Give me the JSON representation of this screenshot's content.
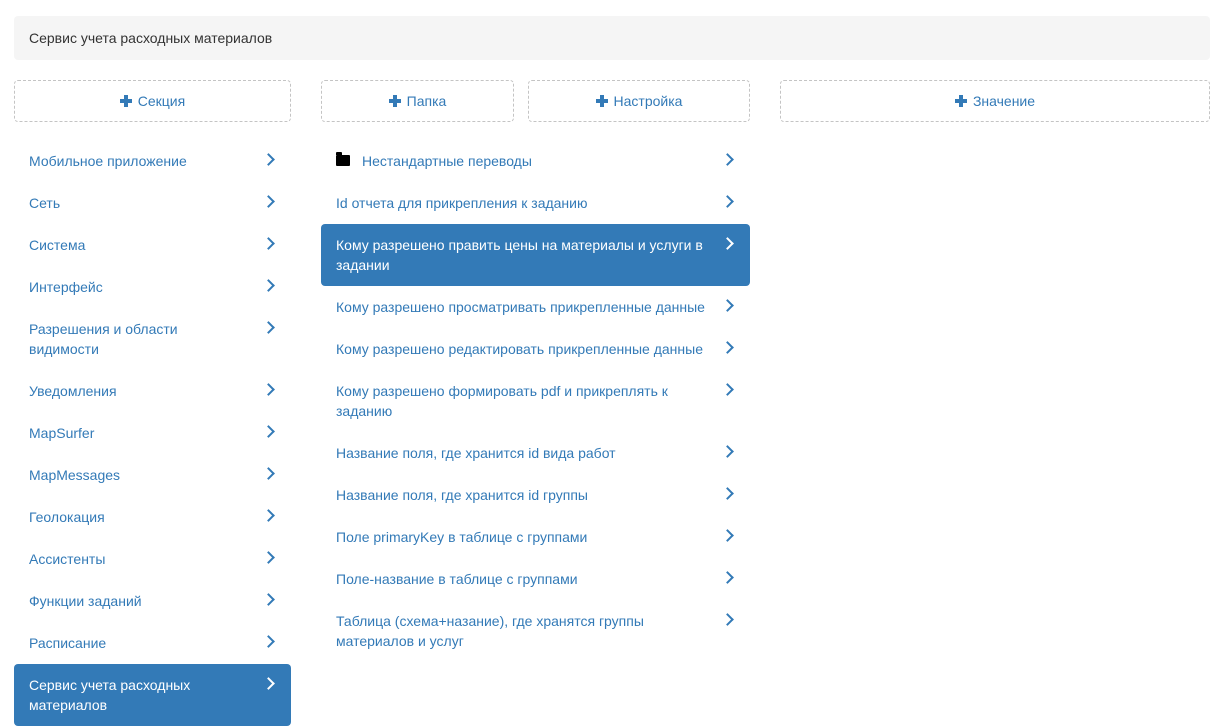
{
  "breadcrumb": "Сервис учета расходных материалов",
  "sections": {
    "add_label": "Секция",
    "items": [
      {
        "label": "Мобильное приложение"
      },
      {
        "label": "Сеть"
      },
      {
        "label": "Система"
      },
      {
        "label": "Интерфейс"
      },
      {
        "label": "Разрешения и области видимости"
      },
      {
        "label": "Уведомления"
      },
      {
        "label": "MapSurfer"
      },
      {
        "label": "MapMessages"
      },
      {
        "label": "Геолокация"
      },
      {
        "label": "Ассистенты"
      },
      {
        "label": "Функции заданий"
      },
      {
        "label": "Расписание"
      },
      {
        "label": "Сервис учета расходных материалов",
        "active": true
      }
    ]
  },
  "items": {
    "add_folder_label": "Папка",
    "add_setting_label": "Настройка",
    "list": [
      {
        "label": "Нестандартные переводы",
        "icon": "folder-icon"
      },
      {
        "label": "Id отчета для прикрепления к заданию"
      },
      {
        "label": "Кому разрешено править цены на материалы и услуги в задании",
        "active": true
      },
      {
        "label": "Кому разрешено просматривать прикрепленные данные"
      },
      {
        "label": "Кому разрешено редактировать прикрепленные данные"
      },
      {
        "label": "Кому разрешено формировать pdf и прикреплять к заданию"
      },
      {
        "label": "Название поля, где хранится id вида работ"
      },
      {
        "label": "Название поля, где хранится id группы"
      },
      {
        "label": "Поле primaryKey в таблице с группами"
      },
      {
        "label": "Поле-название в таблице с группами"
      },
      {
        "label": "Таблица (схема+назание), где хранятся группы материалов и услуг"
      }
    ]
  },
  "values": {
    "add_label": "Значение"
  },
  "colors": {
    "accent": "#337ab7",
    "breadcrumb_bg": "#f5f5f5"
  }
}
